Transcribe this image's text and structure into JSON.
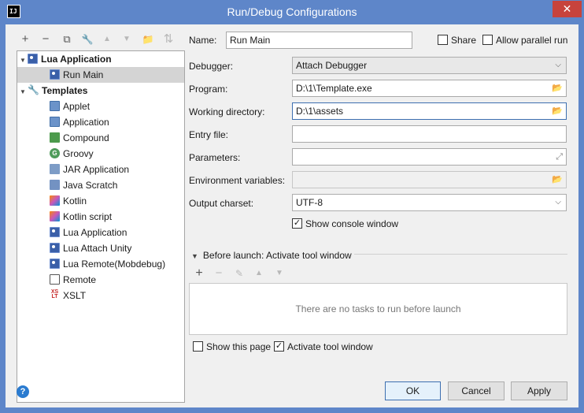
{
  "window": {
    "title": "Run/Debug Configurations",
    "close_label": "✕",
    "app_icon_text": "IJ"
  },
  "toolbar": {
    "add_icon": "+",
    "remove_icon": "−",
    "copy_icon": "⧉",
    "wrench_icon": "🔧",
    "up_icon": "▲",
    "down_icon": "▼",
    "folder_icon": "📁",
    "sort_icon": "⇅"
  },
  "tree": {
    "lua_group": "Lua Application",
    "run_main": "Run Main",
    "templates": "Templates",
    "items": [
      "Applet",
      "Application",
      "Compound",
      "Groovy",
      "JAR Application",
      "Java Scratch",
      "Kotlin",
      "Kotlin script",
      "Lua Application",
      "Lua Attach Unity",
      "Lua Remote(Mobdebug)",
      "Remote",
      "XSLT"
    ]
  },
  "form": {
    "name_label": "Name:",
    "name_value": "Run Main",
    "share_label": "Share",
    "parallel_label": "Allow parallel run",
    "debugger_label": "Debugger:",
    "debugger_value": "Attach Debugger",
    "program_label": "Program:",
    "program_value": "D:\\1\\Template.exe",
    "workdir_label": "Working directory:",
    "workdir_value": "D:\\1\\assets",
    "entry_label": "Entry file:",
    "entry_value": "",
    "params_label": "Parameters:",
    "params_value": "",
    "env_label": "Environment variables:",
    "env_value": "",
    "charset_label": "Output charset:",
    "charset_value": "UTF-8",
    "console_label": "Show console window",
    "console_checked": true
  },
  "before_launch": {
    "title": "Before launch: Activate tool window",
    "empty_text": "There are no tasks to run before launch",
    "show_page_label": "Show this page",
    "activate_label": "Activate tool window"
  },
  "buttons": {
    "ok": "OK",
    "cancel": "Cancel",
    "apply": "Apply",
    "help": "?"
  }
}
